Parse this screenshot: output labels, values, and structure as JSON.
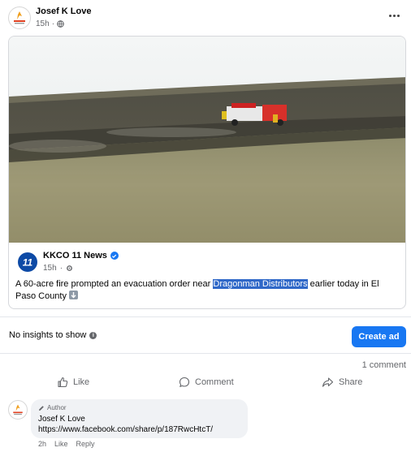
{
  "post": {
    "author": "Josef K Love",
    "time": "15h",
    "visibility_icon": "globe-icon",
    "more_icon": "more-horizontal-icon"
  },
  "shared": {
    "page_name": "KKCO 11 News",
    "page_logo_text": "11",
    "time": "15h",
    "text_before": "A 60-acre fire prompted an evacuation order near ",
    "text_highlight": "Dragonman Distributors",
    "text_after": " earlier today in El Paso County",
    "emoji": "down-arrow-emoji"
  },
  "insights": {
    "text": "No insights to show",
    "create_ad_label": "Create ad"
  },
  "stats": {
    "comments": "1 comment"
  },
  "actions": {
    "like": "Like",
    "comment": "Comment",
    "share": "Share"
  },
  "comment": {
    "badge": "Author",
    "author": "Josef K Love",
    "text": "https://www.facebook.com/share/p/187RwcHtcT/",
    "time": "2h",
    "like": "Like",
    "reply": "Reply"
  },
  "colors": {
    "accent": "#1877f2",
    "highlight": "#2f68c8",
    "muted_text": "#65676b"
  }
}
